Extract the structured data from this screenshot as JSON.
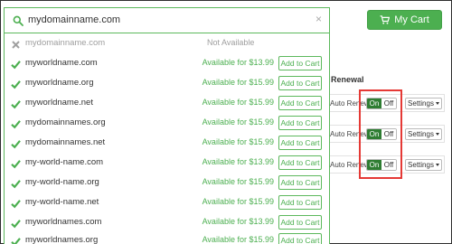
{
  "header": {
    "cart_label": "My Cart"
  },
  "search": {
    "value": "mydomainname.com"
  },
  "results": [
    {
      "domain": "mydomainname.com",
      "available": false,
      "status": "Not Available"
    },
    {
      "domain": "myworldname.com",
      "available": true,
      "price_label": "Available for $13.99",
      "button": "Add to Cart"
    },
    {
      "domain": "myworldname.org",
      "available": true,
      "price_label": "Available for $15.99",
      "button": "Add to Cart"
    },
    {
      "domain": "myworldname.net",
      "available": true,
      "price_label": "Available for $15.99",
      "button": "Add to Cart"
    },
    {
      "domain": "mydomainnames.org",
      "available": true,
      "price_label": "Available for $15.99",
      "button": "Add to Cart"
    },
    {
      "domain": "mydomainnames.net",
      "available": true,
      "price_label": "Available for $15.99",
      "button": "Add to Cart"
    },
    {
      "domain": "my-world-name.com",
      "available": true,
      "price_label": "Available for $13.99",
      "button": "Add to Cart"
    },
    {
      "domain": "my-world-name.org",
      "available": true,
      "price_label": "Available for $15.99",
      "button": "Add to Cart"
    },
    {
      "domain": "my-world-name.net",
      "available": true,
      "price_label": "Available for $15.99",
      "button": "Add to Cart"
    },
    {
      "domain": "myworldnames.com",
      "available": true,
      "price_label": "Available for $13.99",
      "button": "Add to Cart"
    },
    {
      "domain": "myworldnames.org",
      "available": true,
      "price_label": "Available for $15.99",
      "button": "Add to Cart"
    }
  ],
  "renewal": {
    "heading": "Renewal",
    "rows": [
      {
        "label": "Auto Renew",
        "on": "On",
        "off": "Off",
        "settings": "Settings"
      },
      {
        "label": "Auto Renew",
        "on": "On",
        "off": "Off",
        "settings": "Settings"
      },
      {
        "label": "Auto Renew",
        "on": "On",
        "off": "Off",
        "settings": "Settings"
      }
    ]
  },
  "colors": {
    "accent": "#4caf50",
    "toggle_on": "#2e7d32",
    "highlight": "#e53935"
  }
}
